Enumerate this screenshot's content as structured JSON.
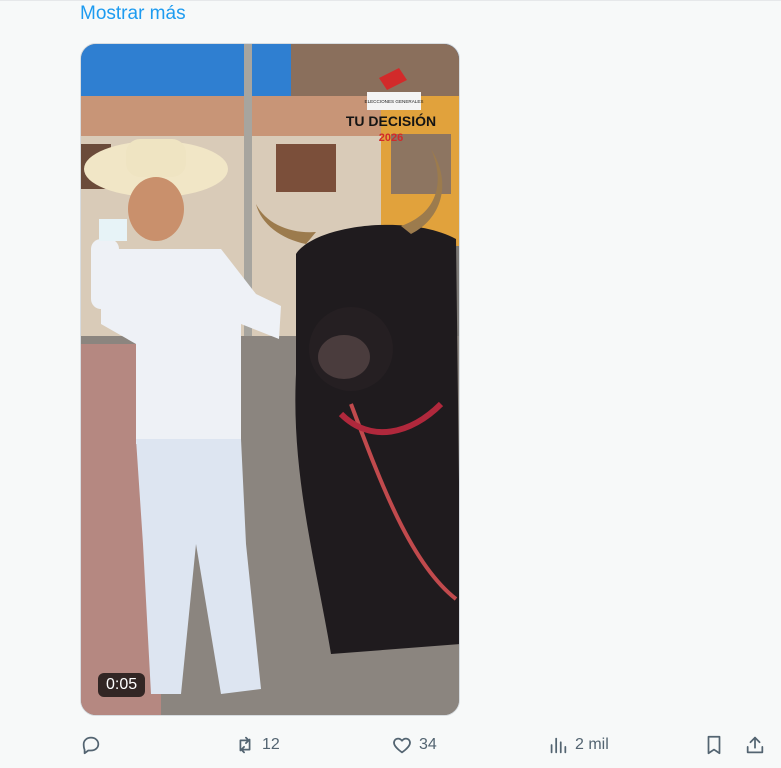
{
  "tweet": {
    "show_more_label": "Mostrar más",
    "video": {
      "duration": "0:05",
      "overlay_brand_line1": "ELECCIONES GENERALES",
      "overlay_brand_line2": "TU DECISIÓN",
      "overlay_brand_year": "2026"
    },
    "actions": {
      "reply_count": "",
      "repost_count": "12",
      "like_count": "34",
      "views_count": "2 mil"
    }
  },
  "colors": {
    "link": "#1d9bf0",
    "icon": "#536471",
    "background": "#f7f9f9"
  }
}
